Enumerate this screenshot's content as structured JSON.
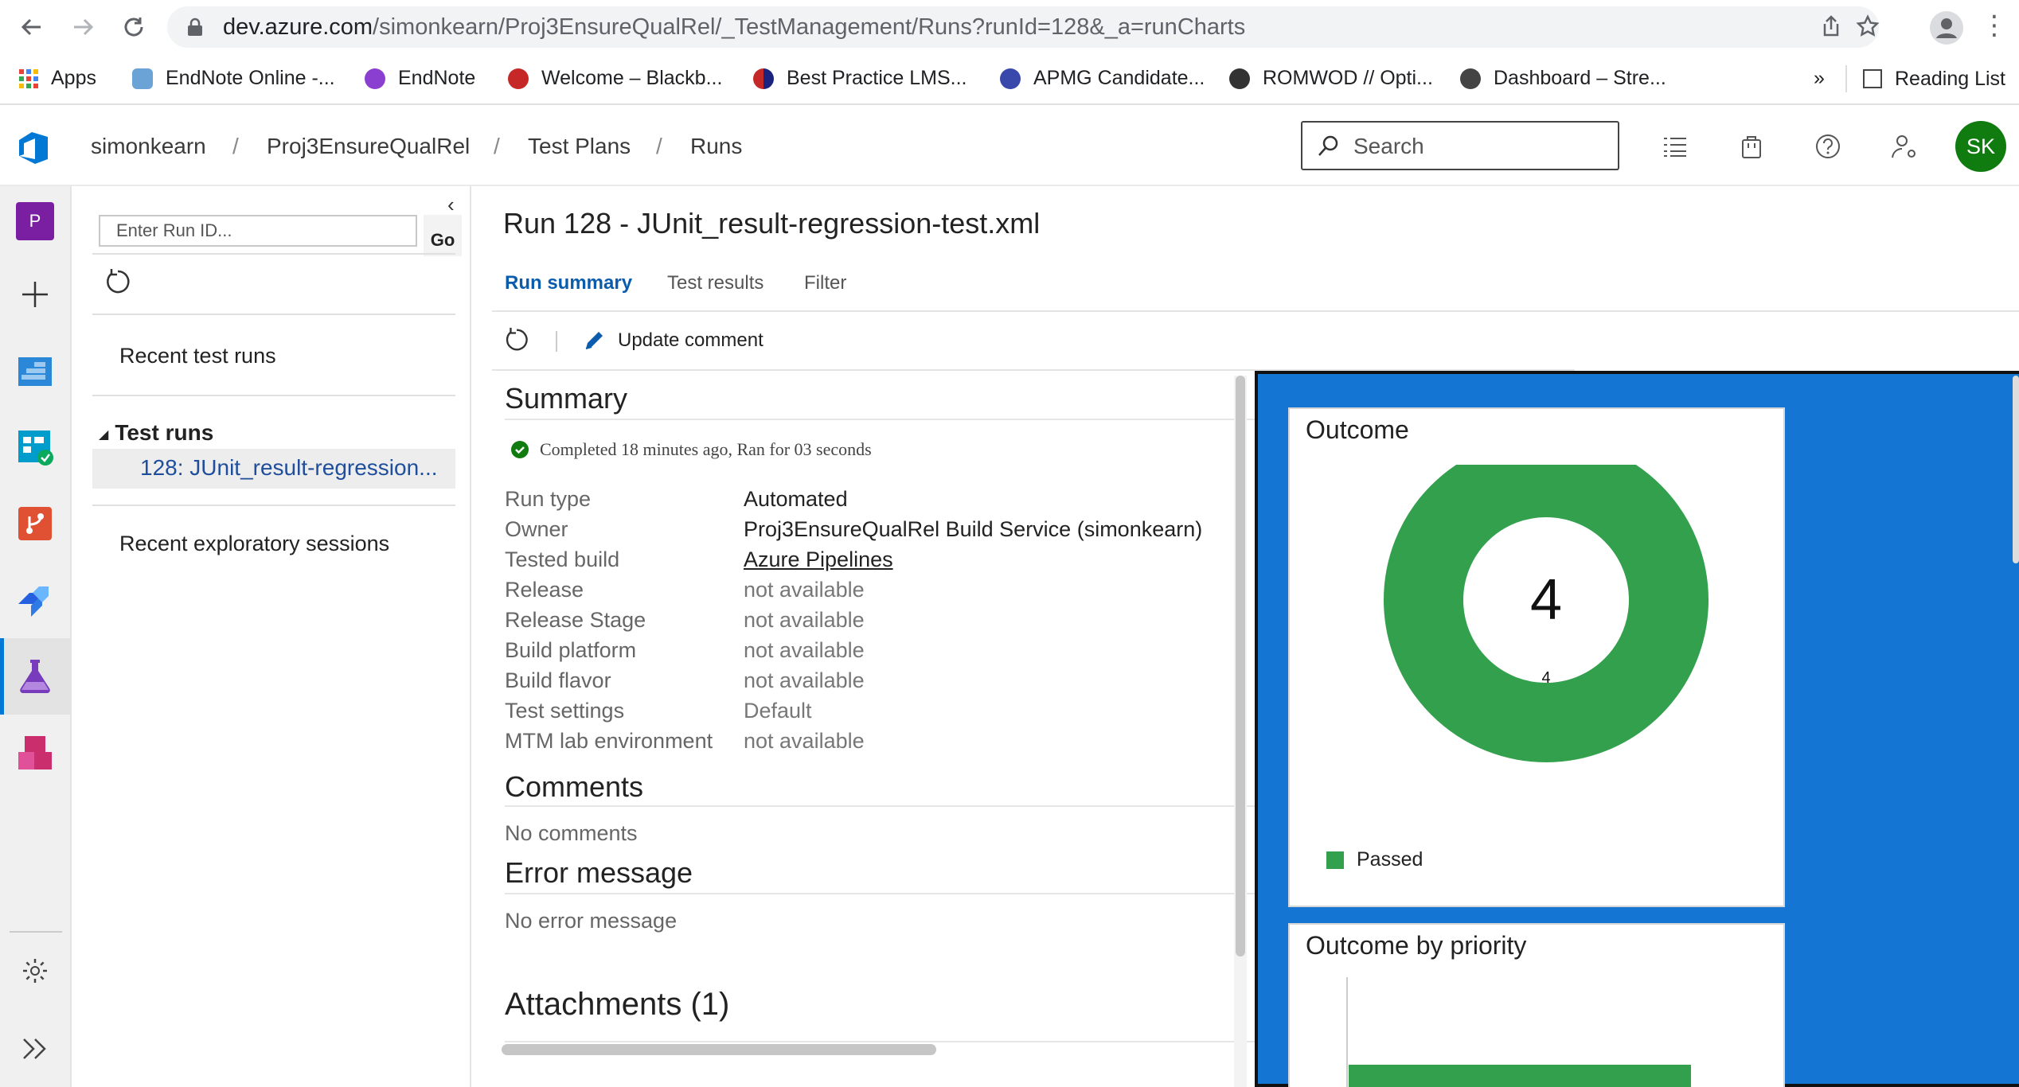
{
  "browser": {
    "url_host": "dev.azure.com",
    "url_path": "/simonkearn/Proj3EnsureQualRel/_TestManagement/Runs?runId=128&_a=runCharts",
    "bookmarks": [
      {
        "label": "Apps",
        "color": "#4285f4"
      },
      {
        "label": "EndNote Online -...",
        "color": "#6ba3d6"
      },
      {
        "label": "EndNote",
        "color": "#8b3fd1"
      },
      {
        "label": "Welcome – Blackb...",
        "color": "#c62828"
      },
      {
        "label": "Best Practice LMS...",
        "color": "#1a237e"
      },
      {
        "label": "APMG Candidate...",
        "color": "#3949ab"
      },
      {
        "label": "ROMWOD // Opti...",
        "color": "#333333"
      },
      {
        "label": "Dashboard – Stre...",
        "color": "#444444"
      }
    ],
    "overflow": "»",
    "reading_list": "Reading List"
  },
  "header": {
    "breadcrumbs": [
      "simonkearn",
      "Proj3EnsureQualRel",
      "Test Plans",
      "Runs"
    ],
    "search_placeholder": "Search",
    "avatar_initials": "SK",
    "accent": "#0078d4"
  },
  "runs_panel": {
    "runid_placeholder": "Enter Run ID...",
    "go_label": "Go",
    "recent_runs": "Recent test runs",
    "tree_head": "Test runs",
    "selected_run": "128: JUnit_result-regression...",
    "recent_exploratory": "Recent exploratory sessions"
  },
  "main": {
    "title": "Run 128 - JUnit_result-regression-test.xml",
    "tabs": [
      "Run summary",
      "Test results",
      "Filter"
    ],
    "toolbar_update": "Update comment",
    "summary_heading": "Summary",
    "status": "Completed 18 minutes ago, Ran for 03 seconds",
    "fields": [
      {
        "label": "Run type",
        "value": "Automated"
      },
      {
        "label": "Owner",
        "value": "Proj3EnsureQualRel Build Service (simonkearn)"
      },
      {
        "label": "Tested build",
        "value": "Azure Pipelines"
      },
      {
        "label": "Release",
        "value": "not available"
      },
      {
        "label": "Release Stage",
        "value": "not available"
      },
      {
        "label": "Build platform",
        "value": "not available"
      },
      {
        "label": "Build flavor",
        "value": "not available"
      },
      {
        "label": "Test settings",
        "value": "Default"
      },
      {
        "label": "MTM lab environment",
        "value": "not available"
      }
    ],
    "comments_heading": "Comments",
    "comments_text": "No comments",
    "error_heading": "Error message",
    "error_text": "No error message",
    "attachments_heading": "Attachments (1)"
  },
  "charts": {
    "pane_color": "#1476d2",
    "outcome_title": "Outcome",
    "outcome_total": "4",
    "outcome_slice_label": "4",
    "legend_passed": "Passed",
    "passed_color": "#33a04d",
    "priority_title": "Outcome by priority"
  },
  "chart_data": [
    {
      "type": "pie",
      "title": "Outcome",
      "categories": [
        "Passed"
      ],
      "values": [
        4
      ],
      "center_label": "4",
      "legend": "bottom-left"
    },
    {
      "type": "bar",
      "title": "Outcome by priority",
      "series": [
        {
          "name": "Passed",
          "values": [
            4
          ]
        }
      ]
    }
  ]
}
